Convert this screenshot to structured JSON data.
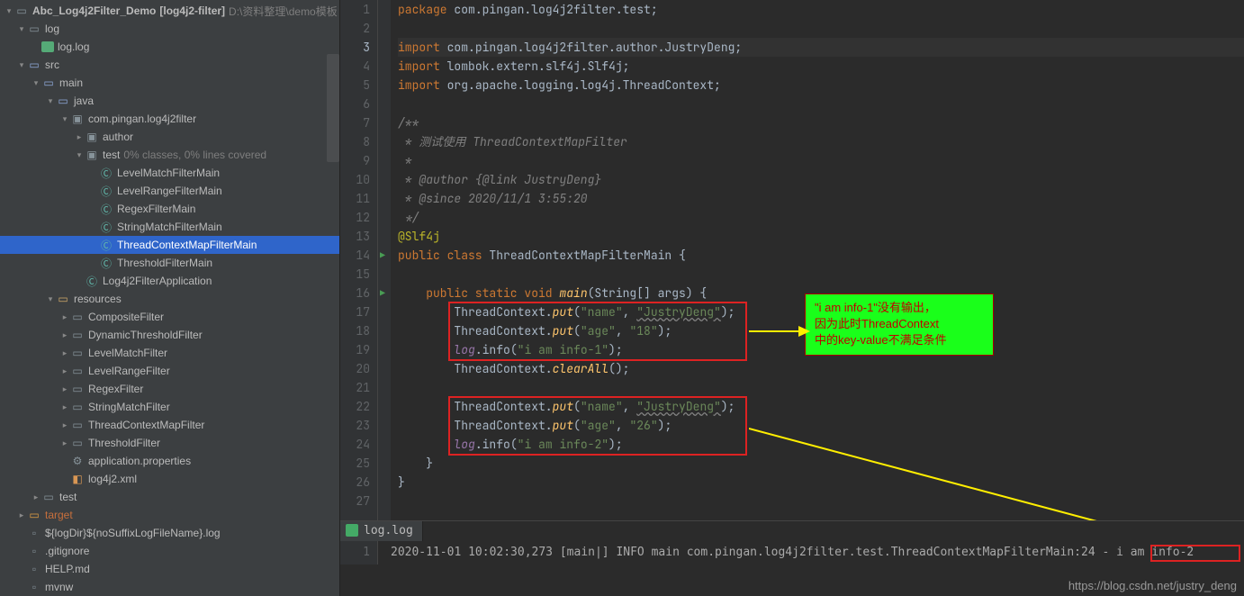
{
  "project": {
    "name": "Abc_Log4j2Filter_Demo",
    "module": "[log4j2-filter]",
    "path": "D:\\资料整理\\demo模板"
  },
  "tree": {
    "log": "log",
    "loglog": "log.log",
    "src": "src",
    "main": "main",
    "java": "java",
    "pkg": "com.pingan.log4j2filter",
    "author": "author",
    "test": "test",
    "testSuffix": "0% classes, 0% lines covered",
    "c1": "LevelMatchFilterMain",
    "c2": "LevelRangeFilterMain",
    "c3": "RegexFilterMain",
    "c4": "StringMatchFilterMain",
    "c5": "ThreadContextMapFilterMain",
    "c6": "ThresholdFilterMain",
    "app": "Log4j2FilterApplication",
    "resources": "resources",
    "r1": "CompositeFilter",
    "r2": "DynamicThresholdFilter",
    "r3": "LevelMatchFilter",
    "r4": "LevelRangeFilter",
    "r5": "RegexFilter",
    "r6": "StringMatchFilter",
    "r7": "ThreadContextMapFilter",
    "r8": "ThresholdFilter",
    "props": "application.properties",
    "xml": "log4j2.xml",
    "testdir": "test",
    "target": "target",
    "tpl": "${logDir}${noSuffixLogFileName}.log",
    "gitignore": ".gitignore",
    "help": "HELP.md",
    "mvnw": "mvnw"
  },
  "code": {
    "l1_a": "package",
    "l1_b": "com.pingan.log4j2filter.test;",
    "l3_a": "import",
    "l3_b": "com.pingan.log4j2filter.author.JustryDeng;",
    "l4_a": "import",
    "l4_b": "lombok.extern.slf4j.Slf4j;",
    "l5_a": "import",
    "l5_b": "org.apache.logging.log4j.ThreadContext;",
    "l7": "/**",
    "l8": " * 测试使用 ThreadContextMapFilter",
    "l9": " *",
    "l10": " * @author {@link JustryDeng}",
    "l11": " * @since 2020/11/1 3:55:20",
    "l12": " */",
    "l13": "@Slf4j",
    "l14_a": "public class",
    "l14_b": "ThreadContextMapFilterMain {",
    "l16_a": "public static void",
    "l16_b": "main",
    "l16_c": "(String[] args) {",
    "tcPut": "ThreadContext.",
    "put": "put",
    "nameK": "\"name\"",
    "nameV": "\"JustryDeng\"",
    "ageK": "\"age\"",
    "age18": "\"18\"",
    "age26": "\"26\"",
    "log": "log",
    "info": "info",
    "info1": "\"i am info-1\"",
    "info2": "\"i am info-2\"",
    "clearAll": "clearAll",
    "paren": "();",
    "brace": "}",
    "braceOpen": "{"
  },
  "callout": {
    "l1": "\"i am info-1\"没有输出，",
    "l2": "因为此时ThreadContext",
    "l3": "中的key-value不满足条件"
  },
  "bottom": {
    "tab": "log.log",
    "ln": "1",
    "line": "2020-11-01 10:02:30,273 [main|]   INFO main com.pingan.log4j2filter.test.ThreadContextMapFilterMain:24 - i am info-2"
  },
  "watermark": "https://blog.csdn.net/justry_deng"
}
